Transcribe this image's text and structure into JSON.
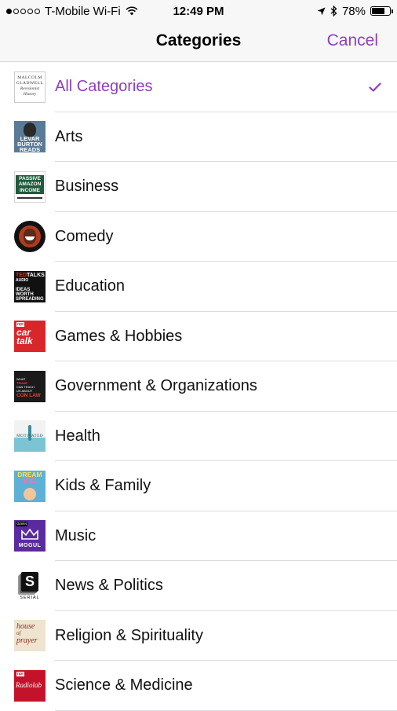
{
  "status_bar": {
    "carrier": "T-Mobile Wi-Fi",
    "time": "12:49 PM",
    "battery": "78%",
    "battery_level": 0.78,
    "signal_bars": 1
  },
  "nav": {
    "title": "Categories",
    "cancel_label": "Cancel"
  },
  "categories": [
    {
      "label": "All Categories",
      "selected": true,
      "thumb_text": [
        "MALCOLM",
        "GLADWELL",
        "Revisionist",
        "History"
      ]
    },
    {
      "label": "Arts",
      "thumb_text": [
        "LEVAR",
        "BURTON",
        "READS"
      ]
    },
    {
      "label": "Business",
      "thumb_text": [
        "PASSIVE",
        "AMAZON",
        "INCOME"
      ]
    },
    {
      "label": "Comedy",
      "thumb_text": []
    },
    {
      "label": "Education",
      "thumb_text": [
        "TED",
        "TALKS",
        "AUDIO",
        "IDEAS",
        "WORTH",
        "SPREADING"
      ]
    },
    {
      "label": "Games & Hobbies",
      "thumb_text": [
        "npr",
        "car",
        "talk"
      ]
    },
    {
      "label": "Government & Organizations",
      "thumb_text": [
        "WHAT",
        "TRUMP",
        "CAN TEACH",
        "US ABOUT",
        "CON LAW"
      ]
    },
    {
      "label": "Health",
      "thumb_text": [
        "MOTIVATED"
      ]
    },
    {
      "label": "Kids & Family",
      "thumb_text": [
        "DREAM",
        "BIG"
      ]
    },
    {
      "label": "Music",
      "thumb_text": [
        "Gimlet",
        "MOGUL"
      ]
    },
    {
      "label": "News & Politics",
      "thumb_text": [
        "S",
        "SERIAL"
      ]
    },
    {
      "label": "Religion & Spirituality",
      "thumb_text": [
        "house",
        "of",
        "prayer"
      ]
    },
    {
      "label": "Science & Medicine",
      "thumb_text": [
        "npr",
        "Radiolab"
      ]
    }
  ],
  "colors": {
    "accent": "#8e3fbd",
    "separator": "#dcdcde",
    "bar_background": "#f7f7f8"
  }
}
